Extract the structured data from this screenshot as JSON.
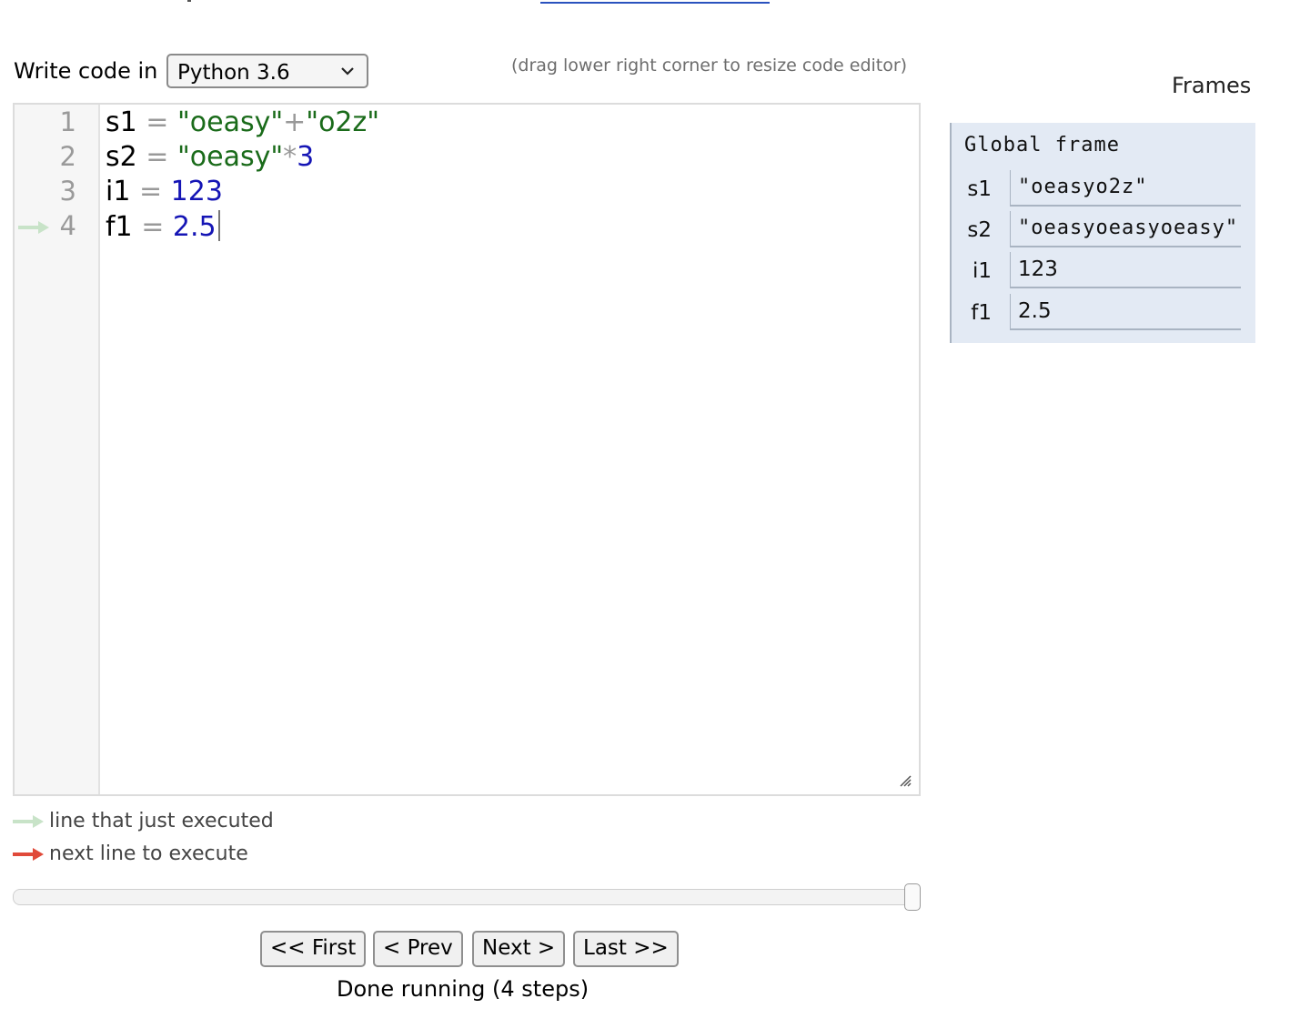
{
  "header": {
    "write_code_label": "Write code in",
    "language_selected": "Python 3.6",
    "drag_hint": "(drag lower right corner to resize code editor)"
  },
  "editor": {
    "lines": [
      {
        "number": "1",
        "var": "s1",
        "op": "=",
        "parts": [
          {
            "t": "str",
            "v": "\"oeasy\""
          },
          {
            "t": "op",
            "v": "+"
          },
          {
            "t": "str",
            "v": "\"o2z\""
          }
        ]
      },
      {
        "number": "2",
        "var": "s2",
        "op": "=",
        "parts": [
          {
            "t": "str",
            "v": "\"oeasy\""
          },
          {
            "t": "op",
            "v": "*"
          },
          {
            "t": "num",
            "v": "3"
          }
        ]
      },
      {
        "number": "3",
        "var": "i1",
        "op": "=",
        "parts": [
          {
            "t": "num",
            "v": "123"
          }
        ]
      },
      {
        "number": "4",
        "var": "f1",
        "op": "=",
        "parts": [
          {
            "t": "num",
            "v": "2.5"
          }
        ]
      }
    ],
    "just_executed_line": 4,
    "colors": {
      "string": "#1a6b1a",
      "number": "#1515b5",
      "operator": "#999999",
      "just_executed_arrow": "#c8e3c8",
      "next_arrow": "#e04a3a"
    }
  },
  "legend": {
    "just_executed": "line that just executed",
    "next_to_execute": "next line to execute"
  },
  "navigation": {
    "first": "<< First",
    "prev": "< Prev",
    "next": "Next >",
    "last": "Last >>",
    "status": "Done running (4 steps)",
    "step_progress": 1.0
  },
  "frames": {
    "title": "Frames",
    "global_frame_label": "Global frame",
    "variables": [
      {
        "name": "s1",
        "value": "\"oeasyo2z\"",
        "type": "string"
      },
      {
        "name": "s2",
        "value": "\"oeasyoeasyoeasy\"",
        "type": "string"
      },
      {
        "name": "i1",
        "value": "123",
        "type": "number"
      },
      {
        "name": "f1",
        "value": "2.5",
        "type": "number"
      }
    ]
  }
}
